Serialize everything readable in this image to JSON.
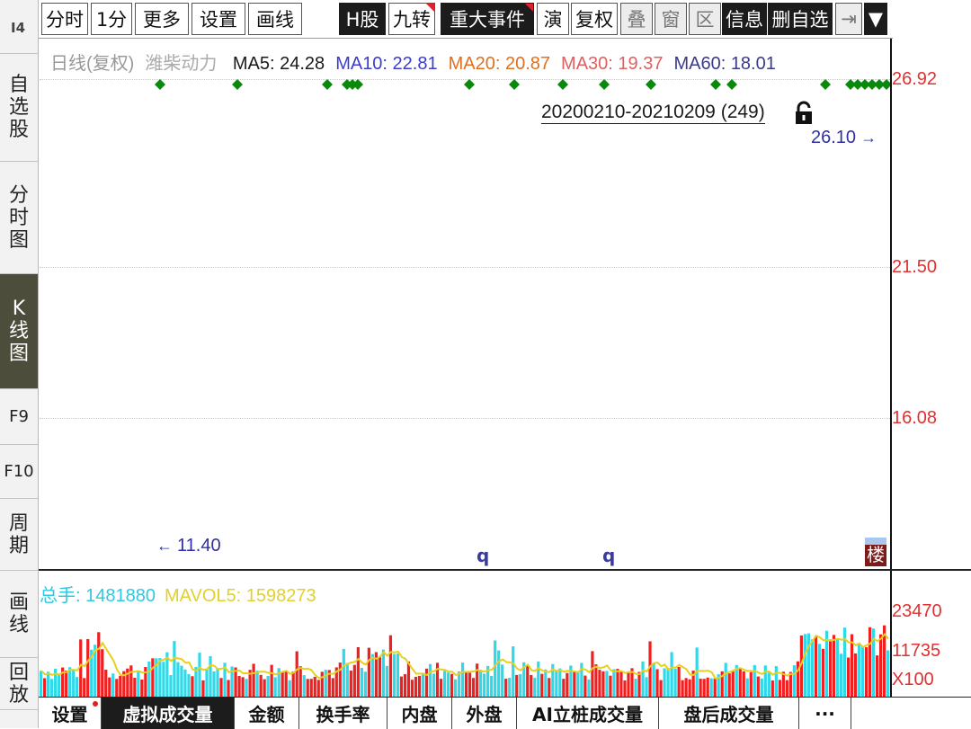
{
  "sidebar": {
    "top_label": "I4",
    "tabs": [
      {
        "label": "自选股",
        "name": "sidebar-tab-watchlist"
      },
      {
        "label": "分时图",
        "name": "sidebar-tab-intraday"
      },
      {
        "label": "K线图",
        "name": "sidebar-tab-kline",
        "active": true
      },
      {
        "label": "F9",
        "name": "sidebar-tab-f9"
      },
      {
        "label": "F10",
        "name": "sidebar-tab-f10"
      },
      {
        "label": "周期",
        "name": "sidebar-tab-period"
      },
      {
        "label": "画线",
        "name": "sidebar-tab-draw"
      },
      {
        "label": "回放",
        "name": "sidebar-tab-replay"
      }
    ]
  },
  "toolbar": {
    "items": [
      {
        "label": "分时",
        "name": "toolbar-intraday-button"
      },
      {
        "label": "1分",
        "name": "toolbar-1min-button"
      },
      {
        "label": "更多",
        "name": "toolbar-more-button"
      },
      {
        "label": "设置",
        "name": "toolbar-settings-button"
      },
      {
        "label": "画线",
        "name": "toolbar-draw-button"
      },
      {
        "label": "H股",
        "name": "toolbar-hshare-button",
        "style": "dark"
      },
      {
        "label": "九转",
        "name": "toolbar-ninetrans-button",
        "mark": true
      },
      {
        "label": "重大事件",
        "name": "toolbar-major-events-button",
        "style": "dark",
        "mark": true
      },
      {
        "label": "演",
        "name": "toolbar-demo-button"
      },
      {
        "label": "复权",
        "name": "toolbar-adjust-button"
      },
      {
        "label": "叠",
        "name": "toolbar-overlay-button",
        "style": "gray"
      },
      {
        "label": "窗",
        "name": "toolbar-window-button",
        "style": "gray"
      },
      {
        "label": "区",
        "name": "toolbar-range-button",
        "style": "gray"
      },
      {
        "label": "信息",
        "name": "toolbar-info-button",
        "style": "dark"
      },
      {
        "label": "删自选",
        "name": "toolbar-remove-watch-button",
        "style": "dark"
      },
      {
        "label": "⇥",
        "name": "toolbar-collapse-button",
        "style": "gray"
      },
      {
        "label": "▼",
        "name": "toolbar-dropdown-button",
        "style": "dark"
      }
    ]
  },
  "chart_header": {
    "title": "日线(复权)",
    "stock": "潍柴动力",
    "ma": [
      {
        "label": "MA5: 24.28",
        "color": "#1a1a1a"
      },
      {
        "label": "MA10: 22.81",
        "color": "#3b3bd0"
      },
      {
        "label": "MA20: 20.87",
        "color": "#e07020"
      },
      {
        "label": "MA30: 19.37",
        "color": "#e06060"
      },
      {
        "label": "MA60: 18.01",
        "color": "#3a3a8a"
      }
    ]
  },
  "price_axis": {
    "labels": [
      "26.92",
      "21.50",
      "16.08"
    ]
  },
  "range_label": "20200210-20210209 (249)",
  "latest_price_label": "26.10",
  "low_price_label": "11.40",
  "q_marks": [
    "q",
    "q"
  ],
  "lou_badge": "楼",
  "signal_dots": [
    178,
    264,
    364,
    386,
    392,
    398,
    522,
    572,
    626,
    672,
    724,
    796,
    814,
    918,
    946,
    954,
    962,
    970,
    978,
    986
  ],
  "volume_header": {
    "total_label": "总手: 1481880",
    "total_color": "#30c8e0",
    "mavol_label": "MAVOL5: 1598273",
    "mavol_color": "#e0d030"
  },
  "volume_axis": {
    "labels": [
      "23470",
      "11735",
      "X100"
    ]
  },
  "bottom_tabs": [
    {
      "label": "设置",
      "name": "bottom-tab-settings",
      "dot": true
    },
    {
      "label": "虚拟成交量",
      "name": "bottom-tab-virtual-volume",
      "style": "dark"
    },
    {
      "label": "金额",
      "name": "bottom-tab-amount"
    },
    {
      "label": "换手率",
      "name": "bottom-tab-turnover"
    },
    {
      "label": "内盘",
      "name": "bottom-tab-inner"
    },
    {
      "label": "外盘",
      "name": "bottom-tab-outer"
    },
    {
      "label": "AI立桩成交量",
      "name": "bottom-tab-ai-volume"
    },
    {
      "label": "盘后成交量",
      "name": "bottom-tab-after-hours"
    },
    {
      "label": "···",
      "name": "bottom-tab-more"
    }
  ],
  "colors": {
    "up": "#f02020",
    "down": "#30d8e8",
    "ma_line": "#e8d020",
    "signal": "#0a8a0a"
  }
}
